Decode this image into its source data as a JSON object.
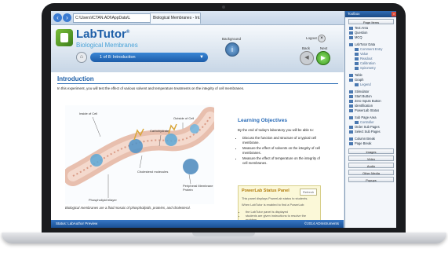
{
  "browser": {
    "address": "C:\\Users\\ICTAN.ADI\\AppData\\L",
    "tab_title": "Biological Membranes - Int..."
  },
  "header": {
    "brand": "LabTutor",
    "brand_mark": "®",
    "subtitle": "Biological Membranes",
    "page_selector": "1 of 8: Introduction",
    "background_label": "Background",
    "logout_label": "Logout",
    "back_label": "Back",
    "next_label": "Next"
  },
  "content": {
    "heading": "Introduction",
    "intro_text": "In this experiment, you will test the effect of various solvent and temperature treatments on the integrity of cell membranes.",
    "figure_labels": {
      "inside": "Inside of Cell",
      "outside": "Outside of Cell",
      "carbohydrate": "Carbohydrate",
      "cholesterol": "Cholesterol molecules",
      "phospholipid": "Phospholipid bilayer",
      "peripheral": "Peripheral Membrane Protein"
    },
    "caption": "Biological membranes are a fluid mosaic of phospholipids, proteins, and cholesterol."
  },
  "objectives": {
    "title": "Learning Objectives",
    "intro": "By the end of today's laboratory you will be able to:",
    "items": [
      "Discuss the function and structure of a typical cell membrane.",
      "Measure the effect of solvents on the integrity of cell membranes.",
      "Measure the effect of temperature on the integrity of cell membranes."
    ]
  },
  "powerlab": {
    "title": "PowerLab Status Panel",
    "refresh": "Refresh",
    "line1": "This panel displays PowerLab status to students.",
    "line2": "When LabTutor is enabled to find a PowerLab:",
    "bullets": [
      "the LabTutor panel is displayed",
      "students are given instructions to resolve the problem"
    ]
  },
  "status_bar": {
    "left": "Status: LabAuthor Preview",
    "right": "©2014 ADInstruments"
  },
  "toolbox": {
    "title": "Toolbox",
    "page_items": "Page Items",
    "items": [
      {
        "label": "Text Area",
        "icon": "text-icon",
        "sub": false
      },
      {
        "label": "Question",
        "icon": "question-icon",
        "sub": false
      },
      {
        "label": "MCQ",
        "icon": "mcq-icon",
        "sub": false
      },
      {
        "label": "LabTutor Data",
        "icon": "data-icon",
        "sub": false
      },
      {
        "label": "Comment Entry",
        "icon": "comment-icon",
        "sub": true
      },
      {
        "label": "Value",
        "icon": "value-icon",
        "sub": true
      },
      {
        "label": "Readout",
        "icon": "readout-icon",
        "sub": true
      },
      {
        "label": "Calibration",
        "icon": "calibration-icon",
        "sub": true
      },
      {
        "label": "Spirometry",
        "icon": "spirometry-icon",
        "sub": true
      },
      {
        "label": "Table",
        "icon": "table-icon",
        "sub": false
      },
      {
        "label": "Graph",
        "icon": "graph-icon",
        "sub": false
      },
      {
        "label": "Legend",
        "icon": "legend-icon",
        "sub": true
      },
      {
        "label": "Stimulator",
        "icon": "stimulator-icon",
        "sub": false
      },
      {
        "label": "Start Button",
        "icon": "start-icon",
        "sub": false
      },
      {
        "label": "Zero Inputs Button",
        "icon": "zero-icon",
        "sub": false
      },
      {
        "label": "Identification",
        "icon": "id-icon",
        "sub": false
      },
      {
        "label": "PowerLab Status",
        "icon": "powerlab-icon",
        "sub": false
      },
      {
        "label": "Sub Page Area",
        "icon": "subpage-icon",
        "sub": false
      },
      {
        "label": "Controller",
        "icon": "controller-icon",
        "sub": true
      },
      {
        "label": "Order Sub Pages",
        "icon": "order-icon",
        "sub": false
      },
      {
        "label": "Select Sub Pages",
        "icon": "select-icon",
        "sub": false
      },
      {
        "label": "Column Break",
        "icon": "column-icon",
        "sub": false
      },
      {
        "label": "Page Break",
        "icon": "pagebreak-icon",
        "sub": false
      }
    ],
    "buttons": [
      "Images",
      "Video",
      "Audio",
      "Other Media",
      "Popups"
    ]
  }
}
